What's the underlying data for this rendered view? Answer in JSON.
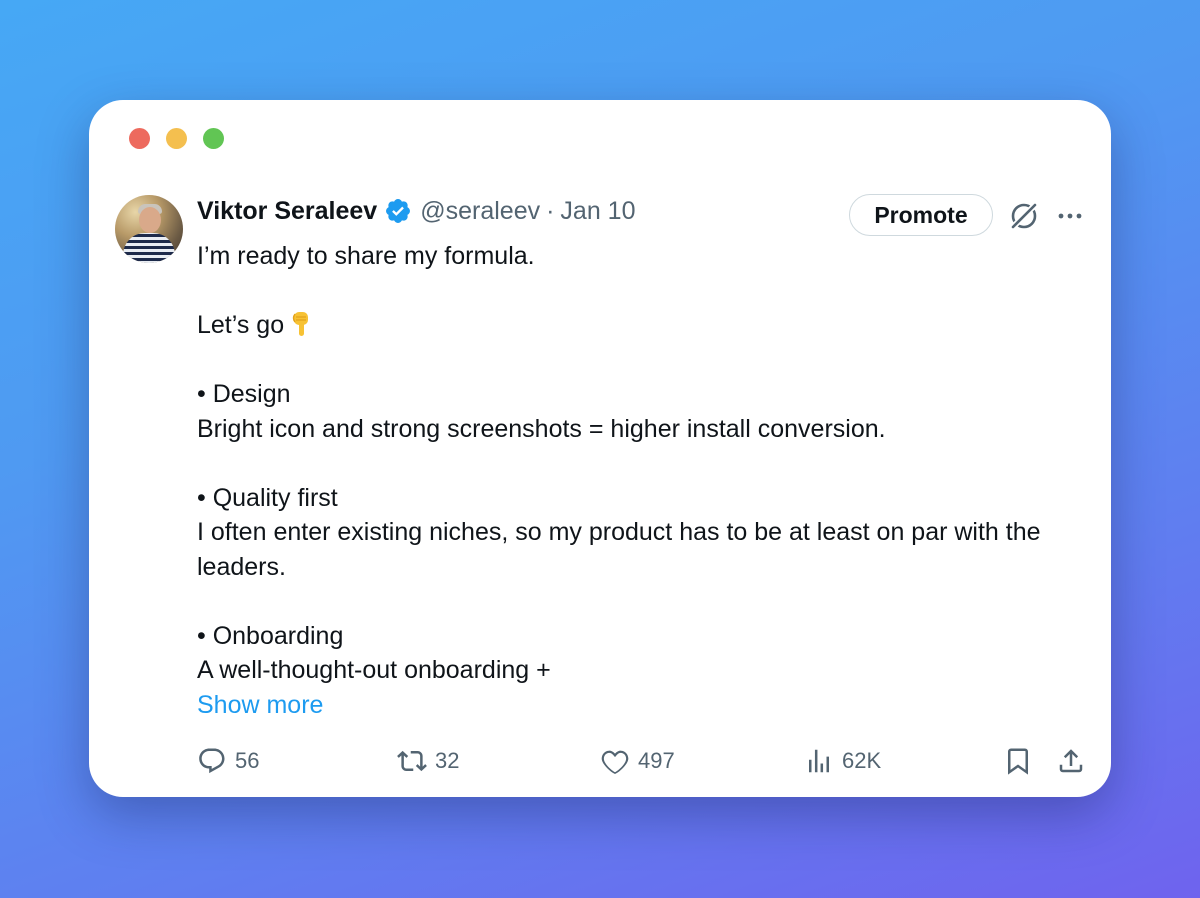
{
  "window": {
    "controls": [
      "close",
      "minimize",
      "maximize"
    ]
  },
  "tweet": {
    "author_name": "Viktor Seraleev",
    "handle": "@seraleev",
    "separator": "·",
    "date": "Jan 10",
    "promote_label": "Promote",
    "paragraphs": [
      "I’m ready to share my formula.",
      "Let’s go"
    ],
    "sections": [
      {
        "title": "• Design",
        "text": "Bright icon and strong screenshots = higher install conversion."
      },
      {
        "title": "• Quality first",
        "text": "I often enter existing niches, so my product has to be at least on par with the leaders."
      },
      {
        "title": "• Onboarding",
        "text": "A well-thought-out onboarding +"
      }
    ],
    "show_more": "Show more",
    "emoji": "backhand-index-pointing-down"
  },
  "metrics": {
    "replies": "56",
    "reposts": "32",
    "likes": "497",
    "views": "62K"
  },
  "icons": {
    "verified": "verified-badge-icon",
    "grok": "grok-icon",
    "more": "more-icon",
    "reply": "reply-icon",
    "repost": "repost-icon",
    "like": "heart-icon",
    "views": "views-icon",
    "bookmark": "bookmark-icon",
    "share": "share-icon"
  },
  "colors": {
    "accent": "#1d9bf0",
    "text": "#0f1419",
    "muted": "#536471",
    "close": "#ed6a5e",
    "minimize": "#f4bf4f",
    "maximize": "#61c554"
  }
}
